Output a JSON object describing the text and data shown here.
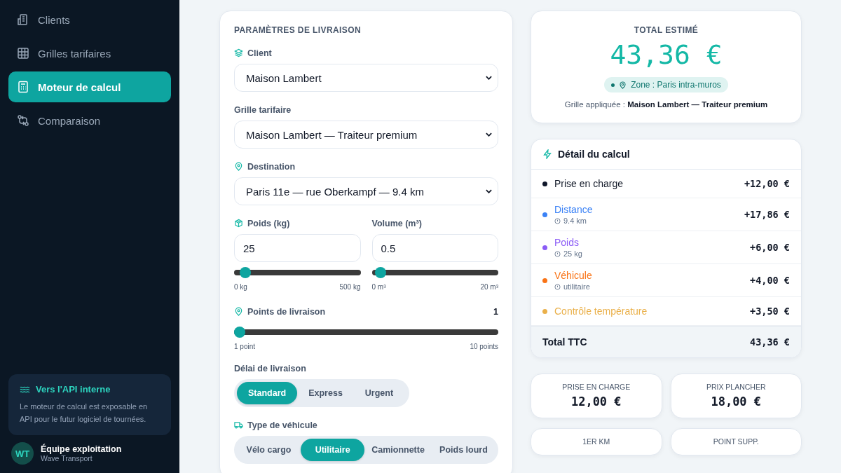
{
  "sidebar": {
    "items": [
      {
        "label": "Clients",
        "kind": "building",
        "selected": false
      },
      {
        "label": "Grilles tarifaires",
        "kind": "grid",
        "selected": false
      },
      {
        "label": "Moteur de calcul",
        "kind": "calculator",
        "selected": true
      },
      {
        "label": "Comparaison",
        "kind": "compare",
        "selected": false
      }
    ],
    "info_card": {
      "title": "Vers l'API interne",
      "text": "Le moteur de calcul est exposable en API pour le futur logiciel de tournées."
    },
    "user": {
      "initials": "WT",
      "name": "Équipe exploitation",
      "company": "Wave Transport"
    }
  },
  "parameters": {
    "title": "PARAMÈTRES DE LIVRAISON",
    "selects": [
      {
        "label": "Client",
        "kind": "layers",
        "value": "Maison Lambert"
      },
      {
        "label": "Grille tarifaire",
        "kind": "plain",
        "value": "Maison Lambert — Traiteur premium"
      },
      {
        "label": "Destination",
        "kind": "pin",
        "value": "Paris 11e — rue Oberkampf — 9.4 km"
      }
    ],
    "measures": [
      {
        "label": "Poids (kg)",
        "kind": "box",
        "value": "25",
        "level": 0.05,
        "min": "0 kg",
        "max": "500 kg"
      },
      {
        "label": "Volume (m³)",
        "kind": "plain",
        "value": "0.5",
        "level": 0.025,
        "min": "0 m³",
        "max": "20 m³"
      }
    ],
    "points": {
      "label": "Points de livraison",
      "value": "1",
      "level": 0,
      "min": "1 point",
      "max": "10 points"
    },
    "delay": {
      "label": "Délai de livraison",
      "options": [
        {
          "label": "Standard",
          "selected": true
        },
        {
          "label": "Express",
          "selected": false
        },
        {
          "label": "Urgent",
          "selected": false
        }
      ]
    },
    "vehicle": {
      "label": "Type de véhicule",
      "options": [
        {
          "label": "Vélo cargo",
          "selected": false
        },
        {
          "label": "Utilitaire",
          "selected": true
        },
        {
          "label": "Camionnette",
          "selected": false
        },
        {
          "label": "Poids lourd",
          "selected": false
        }
      ]
    }
  },
  "total": {
    "title": "TOTAL ESTIMÉ",
    "amount": "43,36 €",
    "zone": "Zone : Paris intra-muros",
    "grid_text": "Grille appliquée : **Maison Lambert — Traiteur premium**"
  },
  "detail": {
    "title": "Détail du calcul",
    "rows": [
      {
        "label": "Prise en charge",
        "color": "#0f172a",
        "amount": "+12,00 €"
      },
      {
        "label": "Distance",
        "color": "#3b82f6",
        "note": "9.4 km",
        "amount": "+17,86 €"
      },
      {
        "label": "Poids",
        "color": "#8b5cf6",
        "note": "25 kg",
        "amount": "+6,00 €"
      },
      {
        "label": "Véhicule",
        "color": "#f97316",
        "note": "utilitaire",
        "amount": "+4,00 €"
      },
      {
        "label": "Contrôle température",
        "color": "#eab04a",
        "amount": "+3,50 €"
      }
    ],
    "total_label": "Total TTC",
    "total_amount": "43,36 €"
  },
  "stats": [
    {
      "label": "PRISE EN CHARGE",
      "value": "12,00 €"
    },
    {
      "label": "PRIX PLANCHER",
      "value": "18,00 €"
    },
    {
      "label": "1ER KM"
    },
    {
      "label": "POINT SUPP."
    }
  ]
}
